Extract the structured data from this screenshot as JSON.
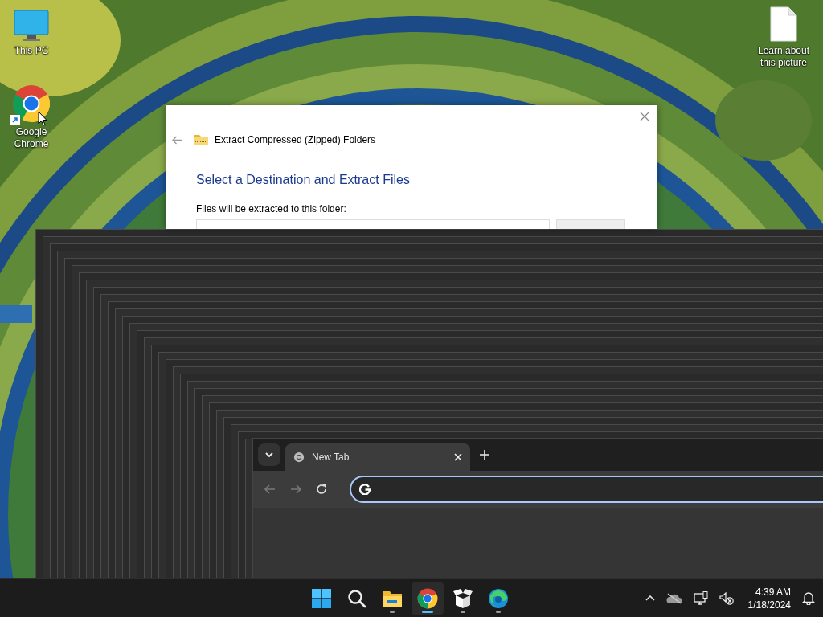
{
  "desktop_icons": [
    {
      "kind": "computer",
      "label": "This PC"
    },
    {
      "kind": "chrome",
      "label": "Google Chrome"
    },
    {
      "kind": "file",
      "label": "Learn about this picture"
    }
  ],
  "dialog": {
    "title": "Extract Compressed (Zipped) Folders",
    "heading": "Select a Destination and Extract Files",
    "field_label": "Files will be extracted to this folder:"
  },
  "browser": {
    "tabs": [
      {
        "label": "New Tab",
        "selected": true
      }
    ]
  },
  "taskbar": {
    "apps": [
      {
        "kind": "start",
        "running": false,
        "selected": false
      },
      {
        "kind": "search",
        "running": false,
        "selected": false
      },
      {
        "kind": "explorer",
        "running": true,
        "selected": false
      },
      {
        "kind": "chrome",
        "running": true,
        "selected": true
      },
      {
        "kind": "box",
        "running": true,
        "selected": false
      },
      {
        "kind": "edge",
        "running": true,
        "selected": false
      }
    ],
    "clock": {
      "time": "4:39 AM",
      "date": "1/18/2024"
    }
  }
}
